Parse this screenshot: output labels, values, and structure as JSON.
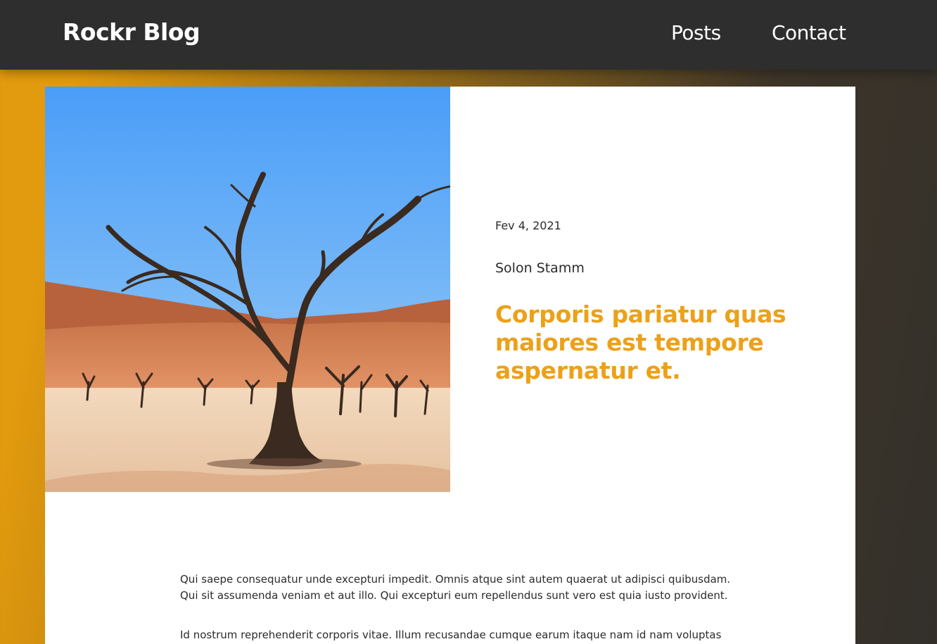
{
  "header": {
    "brand": "Rockr Blog",
    "nav": [
      {
        "label": "Posts"
      },
      {
        "label": "Contact"
      }
    ]
  },
  "post": {
    "date": "Fev 4, 2021",
    "author": "Solon Stamm",
    "title": "Corporis pariatur quas maiores est tempore aspernatur et.",
    "paragraphs": [
      "Qui saepe consequatur unde excepturi impedit. Omnis atque sint autem quaerat ut adipisci quibusdam. Qui sit assumenda veniam et aut illo. Qui excepturi eum repellendus sunt vero est quia iusto provident.",
      "Id nostrum reprehenderit corporis vitae. Illum recusandae cumque earum itaque nam id nam voluptas"
    ]
  },
  "colors": {
    "accent": "#eca11a",
    "navbar": "#2e2e2e"
  }
}
